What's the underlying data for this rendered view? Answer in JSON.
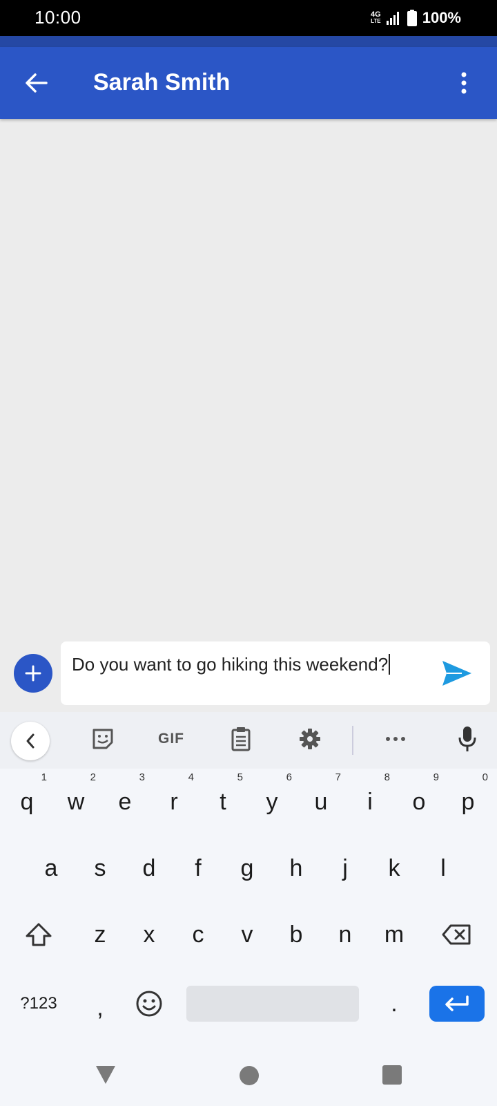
{
  "status_bar": {
    "time": "10:00",
    "network_top": "4G",
    "network_bottom": "LTE",
    "battery": "100%"
  },
  "app_bar": {
    "title": "Sarah Smith",
    "back_icon": "arrow-left-icon",
    "menu_icon": "more-vert-icon"
  },
  "compose": {
    "text": "Do you want to go hiking this weekend?",
    "send_icon": "send-icon",
    "add_icon": "plus-icon"
  },
  "keyboard": {
    "toolbar": {
      "gif_label": "GIF"
    },
    "row1": [
      {
        "key": "q",
        "hint": "1"
      },
      {
        "key": "w",
        "hint": "2"
      },
      {
        "key": "e",
        "hint": "3"
      },
      {
        "key": "r",
        "hint": "4"
      },
      {
        "key": "t",
        "hint": "5"
      },
      {
        "key": "y",
        "hint": "6"
      },
      {
        "key": "u",
        "hint": "7"
      },
      {
        "key": "i",
        "hint": "8"
      },
      {
        "key": "o",
        "hint": "9"
      },
      {
        "key": "p",
        "hint": "0"
      }
    ],
    "row2": [
      "a",
      "s",
      "d",
      "f",
      "g",
      "h",
      "j",
      "k",
      "l"
    ],
    "row3": [
      "z",
      "x",
      "c",
      "v",
      "b",
      "n",
      "m"
    ],
    "row4": {
      "symbols": "?123",
      "comma": ",",
      "period": "."
    }
  },
  "colors": {
    "app_bar": "#2b56c6",
    "send": "#1e9ae0",
    "enter": "#1a73e8"
  }
}
